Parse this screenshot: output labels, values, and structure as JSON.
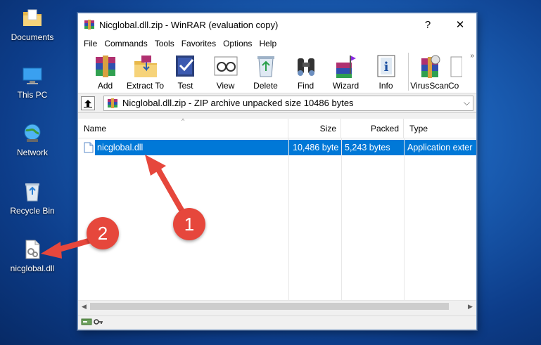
{
  "desktop": {
    "icons": [
      {
        "label": "Documents"
      },
      {
        "label": "This PC"
      },
      {
        "label": "Network"
      },
      {
        "label": "Recycle Bin"
      },
      {
        "label": "nicglobal.dll"
      }
    ]
  },
  "window": {
    "title": "Nicglobal.dll.zip - WinRAR (evaluation copy)",
    "help_glyph": "?",
    "close_glyph": "✕",
    "menu": [
      "File",
      "Commands",
      "Tools",
      "Favorites",
      "Options",
      "Help"
    ],
    "toolbar": [
      "Add",
      "Extract To",
      "Test",
      "View",
      "Delete",
      "Find",
      "Wizard",
      "Info",
      "VirusScan",
      "Co"
    ],
    "toolbar_more": "»",
    "address": {
      "path": "Nicglobal.dll.zip - ZIP archive unpacked size 10486 bytes",
      "dropdown_glyph": "⌵"
    },
    "columns": [
      "Name",
      "Size",
      "Packed",
      "Type"
    ],
    "sort_glyph": "^",
    "files": [
      {
        "name": "nicglobal.dll",
        "size": "10,486 byte",
        "packed": "5,243 bytes",
        "type": "Application exter"
      }
    ]
  },
  "annotations": {
    "badge1": "1",
    "badge2": "2"
  },
  "colors": {
    "selection": "#0078d7",
    "badge": "#e6473c",
    "desktop": "#1b5fb5"
  }
}
